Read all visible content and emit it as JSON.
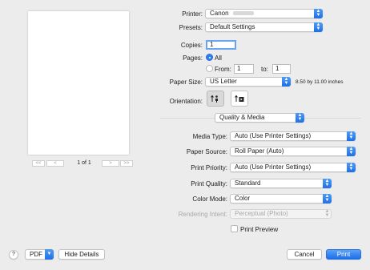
{
  "preview": {
    "page_counter": "1 of 1",
    "first_label": "<<",
    "prev_label": "<",
    "next_label": ">",
    "last_label": ">>"
  },
  "printer": {
    "label": "Printer:",
    "value": "Canon"
  },
  "presets": {
    "label": "Presets:",
    "value": "Default Settings"
  },
  "copies": {
    "label": "Copies:",
    "value": "1"
  },
  "pages": {
    "label": "Pages:",
    "all_label": "All",
    "from_label": "From:",
    "from_value": "1",
    "to_label": "to:",
    "to_value": "1",
    "selected": "All"
  },
  "paper_size": {
    "label": "Paper Size:",
    "value": "US Letter",
    "dimensions": "8.50 by 11.00 inches"
  },
  "orientation": {
    "label": "Orientation:",
    "selected": "portrait"
  },
  "panel_popup": {
    "value": "Quality & Media"
  },
  "media_type": {
    "label": "Media Type:",
    "value": "Auto (Use Printer Settings)"
  },
  "paper_source": {
    "label": "Paper Source:",
    "value": "Roll Paper (Auto)"
  },
  "print_priority": {
    "label": "Print Priority:",
    "value": "Auto (Use Printer Settings)"
  },
  "print_quality": {
    "label": "Print Quality:",
    "value": "Standard"
  },
  "color_mode": {
    "label": "Color Mode:",
    "value": "Color"
  },
  "rendering_intent": {
    "label": "Rendering Intent:",
    "value": "Perceptual (Photo)",
    "enabled": false
  },
  "print_preview": {
    "label": "Print Preview",
    "checked": false
  },
  "footer": {
    "help_label": "?",
    "pdf_label": "PDF",
    "hide_details_label": "Hide Details",
    "cancel_label": "Cancel",
    "print_label": "Print"
  },
  "colors": {
    "accent": "#1f6fe8",
    "background": "#ececec"
  }
}
